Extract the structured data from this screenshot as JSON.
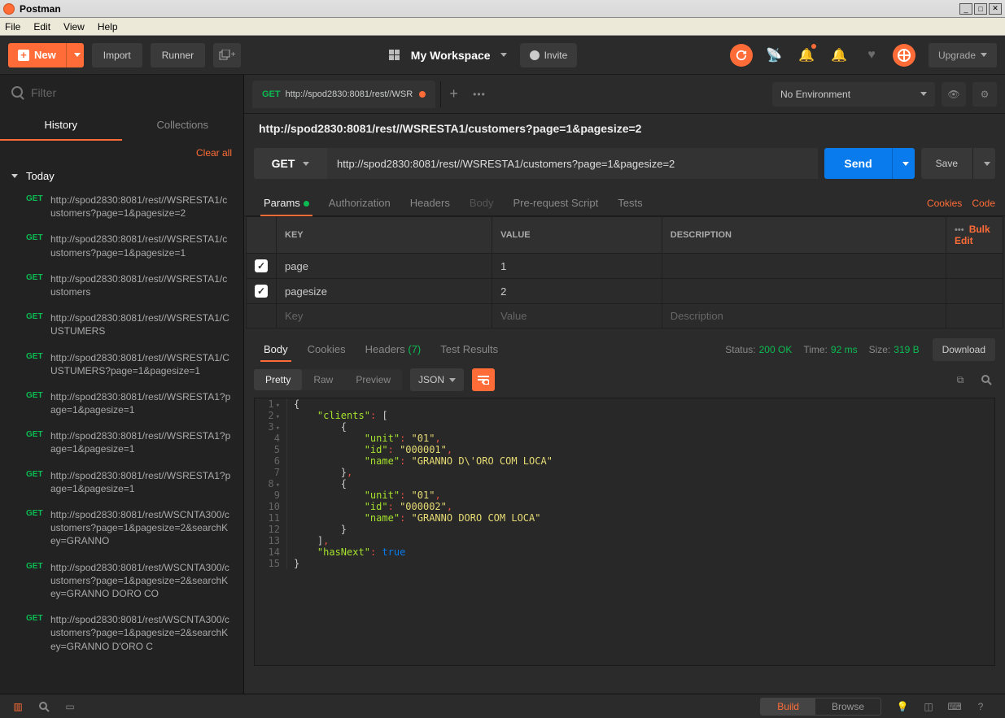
{
  "window": {
    "title": "Postman"
  },
  "menu": {
    "file": "File",
    "edit": "Edit",
    "view": "View",
    "help": "Help"
  },
  "toolbar": {
    "new": "New",
    "import": "Import",
    "runner": "Runner",
    "workspace": "My Workspace",
    "invite": "Invite",
    "upgrade": "Upgrade"
  },
  "sidebar": {
    "filter_placeholder": "Filter",
    "tabs": {
      "history": "History",
      "collections": "Collections"
    },
    "clear_all": "Clear all",
    "section": "Today",
    "history": [
      {
        "method": "GET",
        "url": "http://spod2830:8081/rest//WSRESTA1/customers?page=1&pagesize=2"
      },
      {
        "method": "GET",
        "url": "http://spod2830:8081/rest//WSRESTA1/customers?page=1&pagesize=1"
      },
      {
        "method": "GET",
        "url": "http://spod2830:8081/rest//WSRESTA1/customers"
      },
      {
        "method": "GET",
        "url": "http://spod2830:8081/rest//WSRESTA1/CUSTUMERS"
      },
      {
        "method": "GET",
        "url": "http://spod2830:8081/rest//WSRESTA1/CUSTUMERS?page=1&pagesize=1"
      },
      {
        "method": "GET",
        "url": "http://spod2830:8081/rest//WSRESTA1?page=1&pagesize=1"
      },
      {
        "method": "GET",
        "url": "http://spod2830:8081/rest//WSRESTA1?page=1&pagesize=1"
      },
      {
        "method": "GET",
        "url": "http://spod2830:8081/rest//WSRESTA1?page=1&pagesize=1"
      },
      {
        "method": "GET",
        "url": "http://spod2830:8081/rest/WSCNTA300/customers?page=1&pagesize=2&searchKey=GRANNO"
      },
      {
        "method": "GET",
        "url": "http://spod2830:8081/rest/WSCNTA300/customers?page=1&pagesize=2&searchKey=GRANNO DORO CO"
      },
      {
        "method": "GET",
        "url": "http://spod2830:8081/rest/WSCNTA300/customers?page=1&pagesize=2&searchKey=GRANNO D'ORO C"
      }
    ]
  },
  "request": {
    "tab_method": "GET",
    "tab_label": "http://spod2830:8081/rest//WSR",
    "env": "No Environment",
    "title": "http://spod2830:8081/rest//WSRESTA1/customers?page=1&pagesize=2",
    "method": "GET",
    "url": "http://spod2830:8081/rest//WSRESTA1/customers?page=1&pagesize=2",
    "send": "Send",
    "save": "Save",
    "tabs": {
      "params": "Params",
      "auth": "Authorization",
      "headers": "Headers",
      "body": "Body",
      "prereq": "Pre-request Script",
      "tests": "Tests",
      "cookies": "Cookies",
      "code": "Code"
    },
    "param_table": {
      "key_h": "KEY",
      "value_h": "VALUE",
      "desc_h": "DESCRIPTION",
      "bulk": "Bulk Edit",
      "rows": [
        {
          "key": "page",
          "value": "1"
        },
        {
          "key": "pagesize",
          "value": "2"
        }
      ],
      "ph_key": "Key",
      "ph_value": "Value",
      "ph_desc": "Description"
    }
  },
  "response": {
    "tabs": {
      "body": "Body",
      "cookies": "Cookies",
      "headers": "Headers",
      "headers_count": "(7)",
      "test": "Test Results"
    },
    "status_l": "Status:",
    "status_v": "200 OK",
    "time_l": "Time:",
    "time_v": "92 ms",
    "size_l": "Size:",
    "size_v": "319 B",
    "download": "Download",
    "view": {
      "pretty": "Pretty",
      "raw": "Raw",
      "preview": "Preview",
      "format": "JSON"
    },
    "body_json": {
      "clients": [
        {
          "unit": "01",
          "id": "000001",
          "name": "GRANNO D'ORO COM LOCA"
        },
        {
          "unit": "01",
          "id": "000002",
          "name": "GRANNO DORO COM LOCA"
        }
      ],
      "hasNext": true
    }
  },
  "bottombar": {
    "build": "Build",
    "browse": "Browse"
  }
}
